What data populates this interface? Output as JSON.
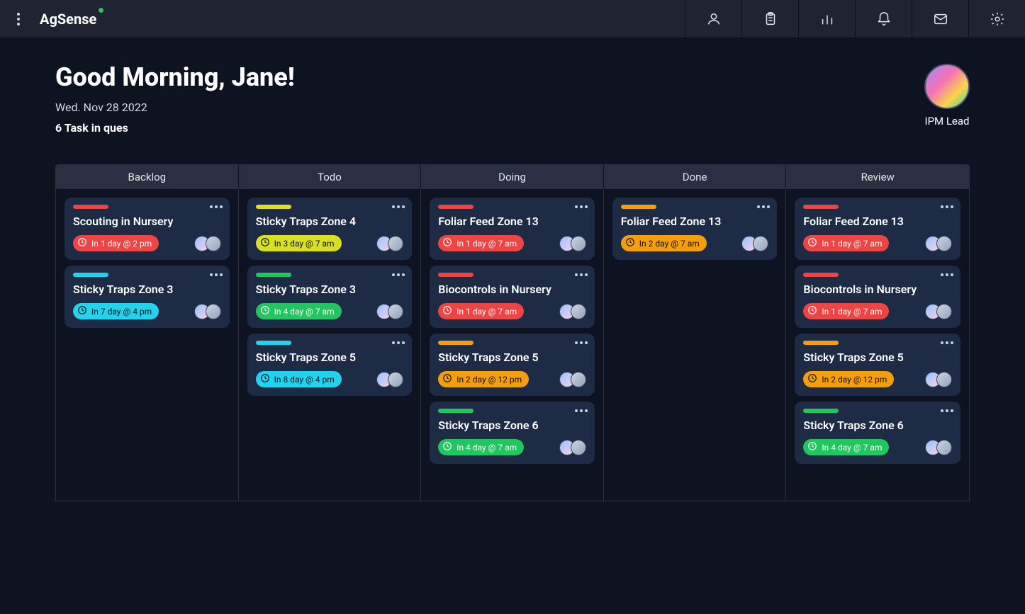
{
  "app": {
    "name": "AgSense"
  },
  "header": {
    "greeting": "Good Morning, Jane!",
    "date": "Wed. Nov 28 2022",
    "tasksInQueue": "6 Task in ques",
    "role": "IPM Lead"
  },
  "columns": [
    "Backlog",
    "Todo",
    "Doing",
    "Done",
    "Review"
  ],
  "board": {
    "Backlog": [
      {
        "title": "Scouting in Nursery",
        "due": "In 1 day @ 2 pm",
        "color": "red",
        "avatars": 2
      },
      {
        "title": "Sticky Traps Zone 3",
        "due": "In 7 day @ 4 pm",
        "color": "cyan",
        "avatars": 2
      }
    ],
    "Todo": [
      {
        "title": "Sticky Traps Zone 4",
        "due": "In 3 day @ 7 am",
        "color": "yellow",
        "avatars": 2
      },
      {
        "title": "Sticky Traps Zone 3",
        "due": "In 4 day @ 7 am",
        "color": "green",
        "avatars": 2
      },
      {
        "title": "Sticky Traps Zone 5",
        "due": "In 8 day @ 4 pm",
        "color": "cyan",
        "avatars": 2
      }
    ],
    "Doing": [
      {
        "title": "Foliar Feed Zone 13",
        "due": "In 1 day @ 7 am",
        "color": "red",
        "avatars": 2
      },
      {
        "title": "Biocontrols in Nursery",
        "due": "In 1 day @ 7 am",
        "color": "red",
        "avatars": 2
      },
      {
        "title": "Sticky Traps Zone 5",
        "due": "In 2 day @ 12 pm",
        "color": "orange",
        "avatars": 2
      },
      {
        "title": "Sticky Traps Zone 6",
        "due": "In 4 day @ 7 am",
        "color": "green",
        "avatars": 2
      }
    ],
    "Done": [
      {
        "title": "Foliar Feed Zone 13",
        "due": "In 2 day @ 7 am",
        "color": "orange",
        "avatars": 2
      }
    ],
    "Review": [
      {
        "title": "Foliar Feed Zone 13",
        "due": "In 1 day @ 7 am",
        "color": "red",
        "avatars": 2
      },
      {
        "title": "Biocontrols in Nursery",
        "due": "In 1 day @ 7 am",
        "color": "red",
        "avatars": 2
      },
      {
        "title": "Sticky Traps Zone 5",
        "due": "In 2 day @ 12 pm",
        "color": "orange",
        "avatars": 2
      },
      {
        "title": "Sticky Traps Zone 6",
        "due": "In 4 day @ 7 am",
        "color": "green",
        "avatars": 2
      }
    ]
  },
  "icons": {
    "profile": "user-icon",
    "clipboard": "clipboard-icon",
    "chart": "bar-chart-icon",
    "bell": "bell-icon",
    "mail": "mail-icon",
    "settings": "gear-icon"
  }
}
